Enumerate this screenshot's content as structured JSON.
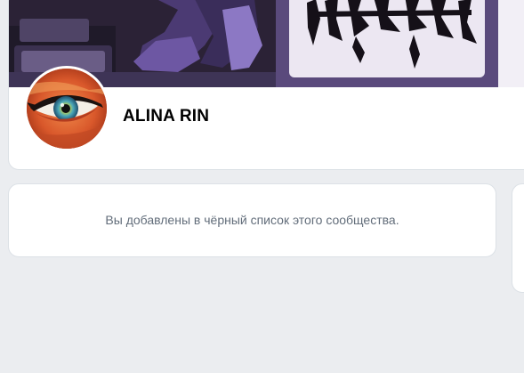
{
  "profile": {
    "name": "ALINA RIN",
    "cover": "cover-image",
    "avatar": "eye-avatar-image"
  },
  "notice": {
    "text": "Вы добавлены в чёрный список этого сообщества."
  },
  "colors": {
    "page_background": "#ebedf0",
    "card_background": "#ffffff",
    "card_border": "#dce1e6",
    "notice_text": "#626d7a",
    "name_text": "#000000"
  }
}
